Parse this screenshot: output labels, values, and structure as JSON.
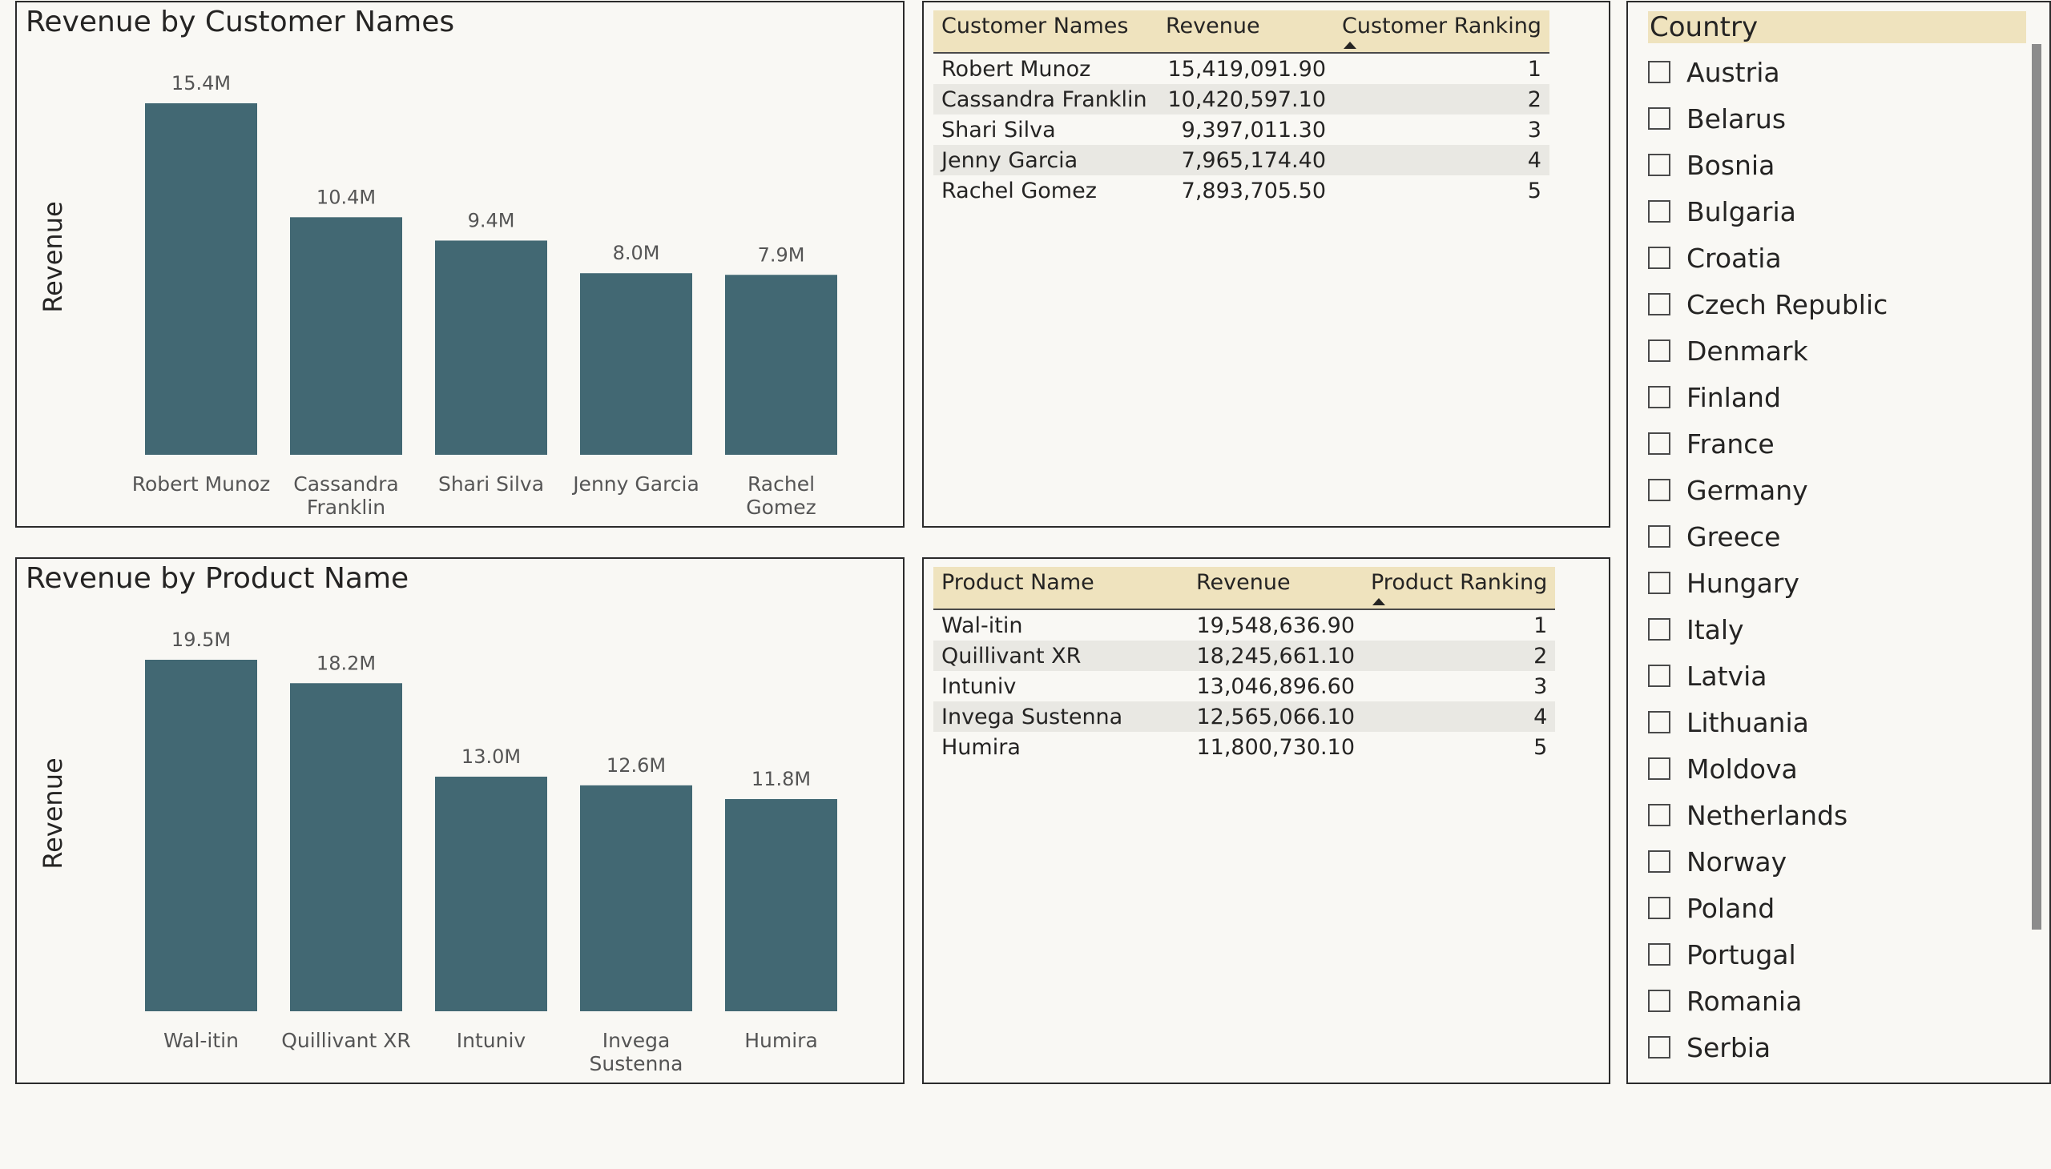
{
  "customer_chart": {
    "title": "Revenue by Customer Names",
    "chart_data": {
      "type": "bar",
      "title": "Revenue by Customer Names",
      "ylabel": "Revenue",
      "xlabel": "",
      "categories": [
        [
          "Robert Munoz"
        ],
        [
          "Cassandra",
          "Franklin"
        ],
        [
          "Shari Silva"
        ],
        [
          "Jenny Garcia"
        ],
        [
          "Rachel",
          "Gomez"
        ]
      ],
      "values": [
        15419091.9,
        10420597.1,
        9397011.3,
        7965174.4,
        7893705.5
      ],
      "data_labels": [
        "15.4M",
        "10.4M",
        "9.4M",
        "8.0M",
        "7.9M"
      ],
      "ylim": [
        0,
        15419091.9
      ],
      "bar_color": "#426873",
      "grid": false
    }
  },
  "product_chart": {
    "title": "Revenue by Product Name",
    "chart_data": {
      "type": "bar",
      "title": "Revenue by Product Name",
      "ylabel": "Revenue",
      "xlabel": "",
      "categories": [
        [
          "Wal-itin"
        ],
        [
          "Quillivant XR"
        ],
        [
          "Intuniv"
        ],
        [
          "Invega",
          "Sustenna"
        ],
        [
          "Humira"
        ]
      ],
      "values": [
        19548636.9,
        18245661.1,
        13046896.6,
        12565066.1,
        11800730.1
      ],
      "data_labels": [
        "19.5M",
        "18.2M",
        "13.0M",
        "12.6M",
        "11.8M"
      ],
      "ylim": [
        0,
        19548636.9
      ],
      "bar_color": "#426873",
      "grid": false
    }
  },
  "customer_table": {
    "headers": [
      "Customer Names",
      "Revenue",
      "Customer Ranking"
    ],
    "rows": [
      [
        "Robert Munoz",
        "15,419,091.90",
        "1"
      ],
      [
        "Cassandra Franklin",
        "10,420,597.10",
        "2"
      ],
      [
        "Shari Silva",
        "9,397,011.30",
        "3"
      ],
      [
        "Jenny Garcia",
        "7,965,174.40",
        "4"
      ],
      [
        "Rachel Gomez",
        "7,893,705.50",
        "5"
      ]
    ]
  },
  "product_table": {
    "headers": [
      "Product Name",
      "Revenue",
      "Product Ranking"
    ],
    "rows": [
      [
        "Wal-itin",
        "19,548,636.90",
        "1"
      ],
      [
        "Quillivant XR",
        "18,245,661.10",
        "2"
      ],
      [
        "Intuniv",
        "13,046,896.60",
        "3"
      ],
      [
        "Invega Sustenna",
        "12,565,066.10",
        "4"
      ],
      [
        "Humira",
        "11,800,730.10",
        "5"
      ]
    ]
  },
  "country_slicer": {
    "title": "Country",
    "items": [
      "Austria",
      "Belarus",
      "Bosnia",
      "Bulgaria",
      "Croatia",
      "Czech Republic",
      "Denmark",
      "Finland",
      "France",
      "Germany",
      "Greece",
      "Hungary",
      "Italy",
      "Latvia",
      "Lithuania",
      "Moldova",
      "Netherlands",
      "Norway",
      "Poland",
      "Portugal",
      "Romania",
      "Serbia"
    ]
  }
}
